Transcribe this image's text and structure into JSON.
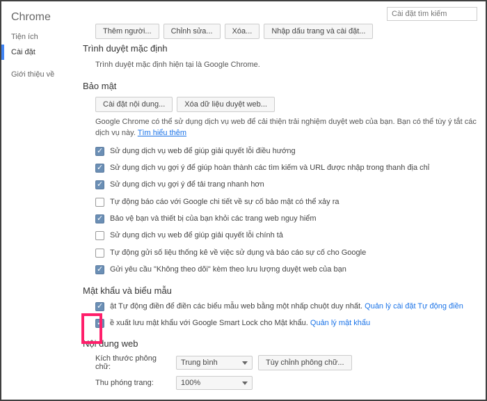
{
  "sidebar": {
    "title": "Chrome",
    "items": [
      "Tiện ích",
      "Cài đặt",
      "Giới thiệu về"
    ],
    "activeIndex": 1
  },
  "search": {
    "placeholder": "Cài đặt tìm kiếm"
  },
  "topButtons": {
    "addPerson": "Thêm người...",
    "edit": "Chỉnh sửa...",
    "delete": "Xóa...",
    "import": "Nhập dấu trang và cài đặt..."
  },
  "defaultBrowser": {
    "heading": "Trình duyệt mặc định",
    "text": "Trình duyệt mặc định hiện tại là Google Chrome."
  },
  "privacy": {
    "heading": "Bảo mật",
    "btnContent": "Cài đặt nội dung...",
    "btnClear": "Xóa dữ liệu duyệt web...",
    "desc1": "Google Chrome có thể sử dụng dịch vụ web để cải thiện trải nghiệm duyệt web của bạn. Bạn có thể tùy ý tắt các dịch vụ này. ",
    "learnMore": "Tìm hiểu thêm",
    "opts": [
      {
        "checked": true,
        "label": "Sử dụng dịch vụ web để giúp giải quyết lỗi điều hướng"
      },
      {
        "checked": true,
        "label": "Sử dụng dịch vụ gợi ý để giúp hoàn thành các tìm kiếm và URL được nhập trong thanh địa chỉ"
      },
      {
        "checked": true,
        "label": "Sử dụng dịch vụ gợi ý để tải trang nhanh hơn"
      },
      {
        "checked": false,
        "label": "Tự động báo cáo với Google chi tiết về sự cố bảo mật có thể xảy ra"
      },
      {
        "checked": true,
        "label": "Bảo vệ bạn và thiết bị của bạn khỏi các trang web nguy hiểm"
      },
      {
        "checked": false,
        "label": "Sử dụng dịch vụ web để giúp giải quyết lỗi chính tả"
      },
      {
        "checked": false,
        "label": "Tự động gửi số liệu thống kê về việc sử dụng và báo cáo sự cố cho Google"
      },
      {
        "checked": true,
        "label": "Gửi yêu cầu \"Không theo dõi\" kèm theo lưu lượng duyệt web của bạn"
      }
    ]
  },
  "passwords": {
    "heading": "Mật khẩu và biểu mẫu",
    "opt1pre": "ật Tự động điền để điền các biểu mẫu web bằng một nhấp chuột duy nhất. ",
    "opt1link": "Quản lý cài đặt Tự động điền",
    "opt2pre": "ề xuất lưu mật khẩu với Google Smart Lock cho Mật khẩu. ",
    "opt2link": "Quản lý mật khẩu"
  },
  "webContent": {
    "heading": "Nội dung web",
    "fontSizeLabel": "Kích thước phông chữ:",
    "fontSizeValue": "Trung bình",
    "customizeFont": "Tùy chỉnh phông chữ...",
    "zoomLabel": "Thu phóng trang:",
    "zoomValue": "100%"
  }
}
